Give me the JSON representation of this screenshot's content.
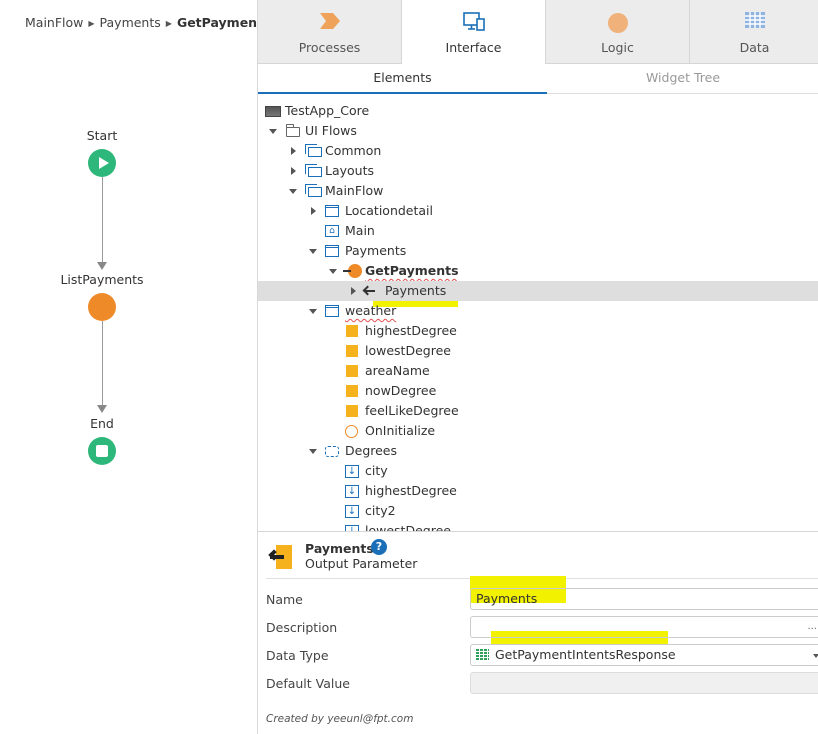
{
  "breadcrumb": {
    "items": [
      "MainFlow",
      "Payments"
    ],
    "current": "GetPayments"
  },
  "flow": {
    "start_label": "Start",
    "action_label": "ListPayments",
    "end_label": "End",
    "colors": {
      "start": "#2db77a",
      "action": "#ef8a29",
      "end": "#2db77a"
    }
  },
  "tabs": [
    {
      "label": "Processes",
      "icon": "processes-chevron-icon"
    },
    {
      "label": "Interface",
      "icon": "interface-monitor-icon",
      "active": true
    },
    {
      "label": "Logic",
      "icon": "logic-circle-icon"
    },
    {
      "label": "Data",
      "icon": "data-grid-icon"
    }
  ],
  "subtabs": {
    "elements": "Elements",
    "widget_tree": "Widget Tree"
  },
  "tree": {
    "app": "TestApp_Core",
    "ui_flows": "UI Flows",
    "common": "Common",
    "layouts": "Layouts",
    "mainflow": "MainFlow",
    "locationdetail": "Locationdetail",
    "main": "Main",
    "payments_screen": "Payments",
    "getpayments": "GetPayments",
    "payments_output": "Payments",
    "weather": "weather",
    "highestDegree": "highestDegree",
    "lowestDegree": "lowestDegree",
    "areaName": "areaName",
    "nowDegree": "nowDegree",
    "feelLikeDegree": "feelLikeDegree",
    "onInitialize": "OnInitialize",
    "degrees": "Degrees",
    "city": "city",
    "highestDegree2": "highestDegree",
    "city2": "city2",
    "lowestDegree2": "lowestDegree"
  },
  "properties": {
    "title": "Payments",
    "subtitle": "Output Parameter",
    "help": "?",
    "name_label": "Name",
    "name_value": "Payments",
    "description_label": "Description",
    "description_value": "",
    "description_more": "...",
    "data_type_label": "Data Type",
    "data_type_value": "GetPaymentIntentsResponse",
    "default_value_label": "Default Value",
    "default_value": "",
    "footer": "Created by yeeunl@fpt.com"
  },
  "colors": {
    "accent": "#1a6fb8",
    "highlight": "#f2f200",
    "variable": "#f5b21d"
  }
}
